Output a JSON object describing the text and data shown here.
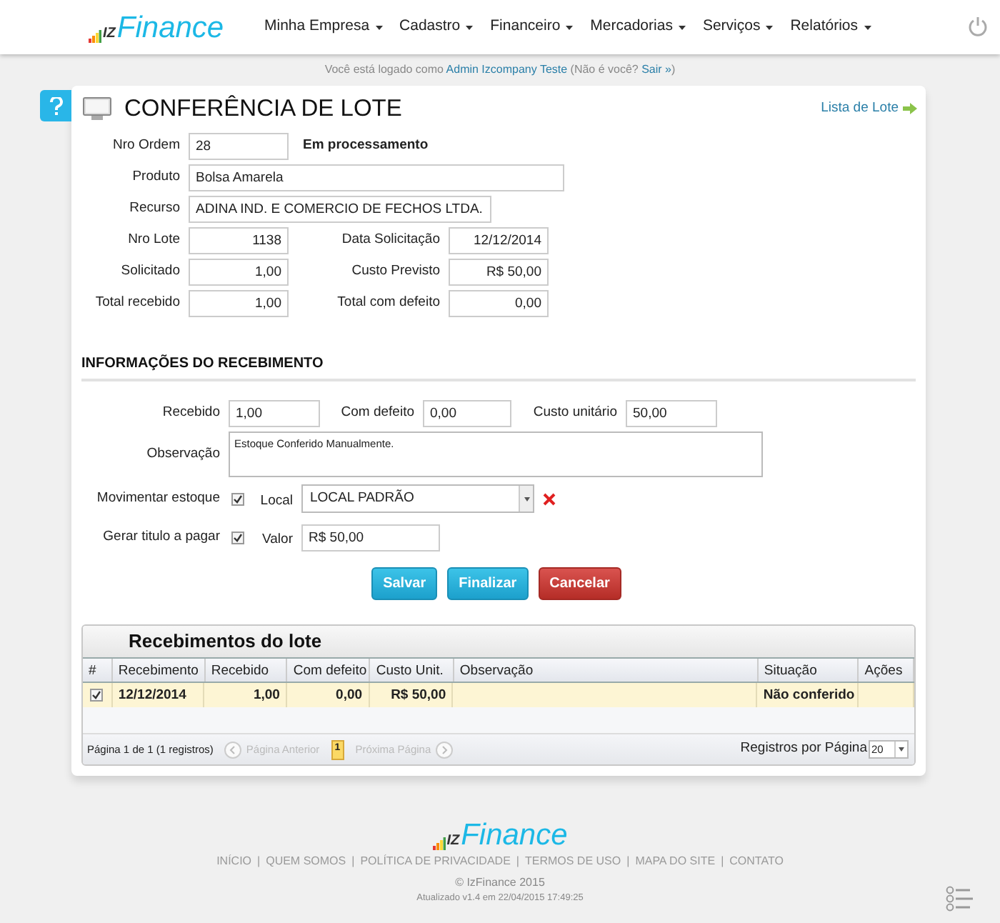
{
  "header": {
    "logo": {
      "mark": "IZ",
      "name": "Finance"
    },
    "menu": [
      {
        "label": "Minha Empresa"
      },
      {
        "label": "Cadastro"
      },
      {
        "label": "Financeiro"
      },
      {
        "label": "Mercadorias"
      },
      {
        "label": "Serviços"
      },
      {
        "label": "Relatórios"
      }
    ]
  },
  "login_notice": {
    "before": "Você está logado como",
    "user": "Admin Izcompany Teste",
    "middle": "(Não é você?",
    "logout": "Sair »",
    "after": ")"
  },
  "page": {
    "title": "CONFERÊNCIA DE LOTE",
    "list_link": "Lista de Lote"
  },
  "order": {
    "nro_ordem": {
      "label": "Nro Ordem",
      "value": "28"
    },
    "status": "Em processamento",
    "produto": {
      "label": "Produto",
      "value": "Bolsa Amarela"
    },
    "recurso": {
      "label": "Recurso",
      "value": "ADINA IND. E COMERCIO DE FECHOS LTDA."
    },
    "pairs": [
      [
        {
          "label": "Nro Lote",
          "value": "1138"
        },
        {
          "label": "Data Solicitação",
          "value": "12/12/2014"
        }
      ],
      [
        {
          "label": "Solicitado",
          "value": "1,00"
        },
        {
          "label": "Custo Previsto",
          "value": "R$ 50,00"
        }
      ],
      [
        {
          "label": "Total recebido",
          "value": "1,00"
        },
        {
          "label": "Total com defeito",
          "value": "0,00"
        }
      ]
    ]
  },
  "receipt": {
    "title": "INFORMAÇÕES DO RECEBIMENTO",
    "recebido": {
      "label": "Recebido",
      "value": "1,00"
    },
    "com_defeito": {
      "label": "Com defeito",
      "value": "0,00"
    },
    "custo_unitario": {
      "label": "Custo unitário",
      "value": "50,00"
    },
    "observacao": {
      "label": "Observação",
      "value": "Estoque Conferido Manualmente."
    },
    "movimentar_estoque": {
      "label": "Movimentar estoque",
      "checked": true
    },
    "local": {
      "label": "Local",
      "value": "LOCAL PADRÃO"
    },
    "gerar_titulo": {
      "label": "Gerar titulo a pagar",
      "checked": true
    },
    "valor": {
      "label": "Valor",
      "value": "R$ 50,00"
    },
    "buttons": [
      {
        "label": "Salvar",
        "kind": "primary"
      },
      {
        "label": "Finalizar",
        "kind": "primary"
      },
      {
        "label": "Cancelar",
        "kind": "danger"
      }
    ]
  },
  "grid": {
    "title": "Recebimentos do lote",
    "columns": [
      "#",
      "Recebimento",
      "Recebido",
      "Com defeito",
      "Custo Unit.",
      "Observação",
      "Situação",
      "Ações"
    ],
    "rows": [
      {
        "checked": true,
        "recebimento": "12/12/2014",
        "recebido": "1,00",
        "com_defeito": "0,00",
        "custo_unit": "R$ 50,00",
        "situacao": "Não conferido"
      }
    ],
    "pager": {
      "info": "Página 1 de 1 (1 registros)",
      "prev": {
        "label": "Página Anterior",
        "disabled": true
      },
      "pages": [
        {
          "label": "1",
          "selected": true
        }
      ],
      "next": {
        "label": "Próxima Página",
        "disabled": true
      },
      "per_page_label": "Registros por Página",
      "per_page": "20"
    }
  },
  "footer": {
    "logo": {
      "mark": "IZ",
      "name": "Finance"
    },
    "links": [
      "INÍCIO",
      "QUEM SOMOS",
      "POLÍTICA DE PRIVACIDADE",
      "TERMOS DE USO",
      "MAPA DO SITE",
      "CONTATO"
    ],
    "separator": "|",
    "copyright": "© IzFinance 2015",
    "updated": "Atualizado v1.4 em 22/04/2015 17:49:25"
  }
}
